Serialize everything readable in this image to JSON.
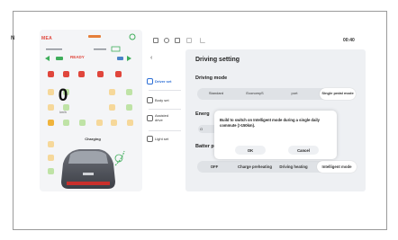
{
  "cluster": {
    "gear": "N",
    "mode_label": "MEA",
    "speed": "0",
    "speed_unit": "km/h",
    "charging_label": "Charging",
    "ready_label": "READY"
  },
  "statusbar": {
    "time": "00:40"
  },
  "sidebar": {
    "back_icon": "chevron-left-icon",
    "items": [
      {
        "label": "Driver set",
        "icon": "steering-wheel-icon",
        "active": true
      },
      {
        "label": "Body set",
        "icon": "car-body-icon",
        "active": false
      },
      {
        "label": "Assisted drive",
        "icon": "assist-drive-icon",
        "active": false
      },
      {
        "label": "Light set",
        "icon": "light-icon",
        "active": false
      }
    ]
  },
  "main": {
    "title": "Driving setting",
    "driving_mode": {
      "label": "Driving mode",
      "options": [
        "Standard",
        "EconomyS",
        "port",
        "Single pedal mode"
      ],
      "selected_index": 3
    },
    "energy": {
      "label_visible": "Energ",
      "pill_visible": "O"
    },
    "battery": {
      "label_visible": "Batter prehe",
      "options": [
        "OFF",
        "Charge preheating",
        "Driving heating",
        "Intelligent mode"
      ],
      "selected_index": 3
    }
  },
  "dialog": {
    "message": "Build to switch on Intelligent mode during a single daily commute (>150km).",
    "ok_label": "OK",
    "cancel_label": "Cancel"
  },
  "colors": {
    "accent": "#2c6ed5",
    "panel": "#eef0f3",
    "warning_red": "#e0463c"
  }
}
